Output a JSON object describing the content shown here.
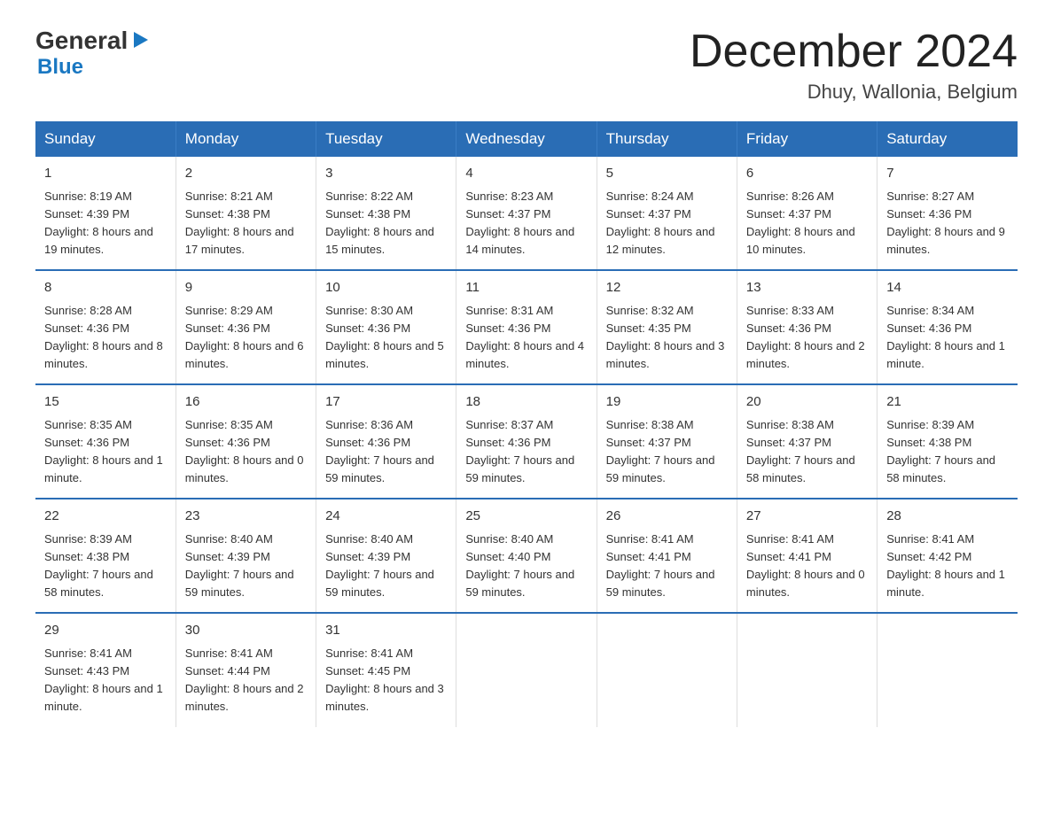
{
  "logo": {
    "general": "General",
    "triangle": "▶",
    "blue": "Blue"
  },
  "title": "December 2024",
  "location": "Dhuy, Wallonia, Belgium",
  "headers": [
    "Sunday",
    "Monday",
    "Tuesday",
    "Wednesday",
    "Thursday",
    "Friday",
    "Saturday"
  ],
  "weeks": [
    [
      {
        "day": "1",
        "sunrise": "8:19 AM",
        "sunset": "4:39 PM",
        "daylight": "8 hours and 19 minutes."
      },
      {
        "day": "2",
        "sunrise": "8:21 AM",
        "sunset": "4:38 PM",
        "daylight": "8 hours and 17 minutes."
      },
      {
        "day": "3",
        "sunrise": "8:22 AM",
        "sunset": "4:38 PM",
        "daylight": "8 hours and 15 minutes."
      },
      {
        "day": "4",
        "sunrise": "8:23 AM",
        "sunset": "4:37 PM",
        "daylight": "8 hours and 14 minutes."
      },
      {
        "day": "5",
        "sunrise": "8:24 AM",
        "sunset": "4:37 PM",
        "daylight": "8 hours and 12 minutes."
      },
      {
        "day": "6",
        "sunrise": "8:26 AM",
        "sunset": "4:37 PM",
        "daylight": "8 hours and 10 minutes."
      },
      {
        "day": "7",
        "sunrise": "8:27 AM",
        "sunset": "4:36 PM",
        "daylight": "8 hours and 9 minutes."
      }
    ],
    [
      {
        "day": "8",
        "sunrise": "8:28 AM",
        "sunset": "4:36 PM",
        "daylight": "8 hours and 8 minutes."
      },
      {
        "day": "9",
        "sunrise": "8:29 AM",
        "sunset": "4:36 PM",
        "daylight": "8 hours and 6 minutes."
      },
      {
        "day": "10",
        "sunrise": "8:30 AM",
        "sunset": "4:36 PM",
        "daylight": "8 hours and 5 minutes."
      },
      {
        "day": "11",
        "sunrise": "8:31 AM",
        "sunset": "4:36 PM",
        "daylight": "8 hours and 4 minutes."
      },
      {
        "day": "12",
        "sunrise": "8:32 AM",
        "sunset": "4:35 PM",
        "daylight": "8 hours and 3 minutes."
      },
      {
        "day": "13",
        "sunrise": "8:33 AM",
        "sunset": "4:36 PM",
        "daylight": "8 hours and 2 minutes."
      },
      {
        "day": "14",
        "sunrise": "8:34 AM",
        "sunset": "4:36 PM",
        "daylight": "8 hours and 1 minute."
      }
    ],
    [
      {
        "day": "15",
        "sunrise": "8:35 AM",
        "sunset": "4:36 PM",
        "daylight": "8 hours and 1 minute."
      },
      {
        "day": "16",
        "sunrise": "8:35 AM",
        "sunset": "4:36 PM",
        "daylight": "8 hours and 0 minutes."
      },
      {
        "day": "17",
        "sunrise": "8:36 AM",
        "sunset": "4:36 PM",
        "daylight": "7 hours and 59 minutes."
      },
      {
        "day": "18",
        "sunrise": "8:37 AM",
        "sunset": "4:36 PM",
        "daylight": "7 hours and 59 minutes."
      },
      {
        "day": "19",
        "sunrise": "8:38 AM",
        "sunset": "4:37 PM",
        "daylight": "7 hours and 59 minutes."
      },
      {
        "day": "20",
        "sunrise": "8:38 AM",
        "sunset": "4:37 PM",
        "daylight": "7 hours and 58 minutes."
      },
      {
        "day": "21",
        "sunrise": "8:39 AM",
        "sunset": "4:38 PM",
        "daylight": "7 hours and 58 minutes."
      }
    ],
    [
      {
        "day": "22",
        "sunrise": "8:39 AM",
        "sunset": "4:38 PM",
        "daylight": "7 hours and 58 minutes."
      },
      {
        "day": "23",
        "sunrise": "8:40 AM",
        "sunset": "4:39 PM",
        "daylight": "7 hours and 59 minutes."
      },
      {
        "day": "24",
        "sunrise": "8:40 AM",
        "sunset": "4:39 PM",
        "daylight": "7 hours and 59 minutes."
      },
      {
        "day": "25",
        "sunrise": "8:40 AM",
        "sunset": "4:40 PM",
        "daylight": "7 hours and 59 minutes."
      },
      {
        "day": "26",
        "sunrise": "8:41 AM",
        "sunset": "4:41 PM",
        "daylight": "7 hours and 59 minutes."
      },
      {
        "day": "27",
        "sunrise": "8:41 AM",
        "sunset": "4:41 PM",
        "daylight": "8 hours and 0 minutes."
      },
      {
        "day": "28",
        "sunrise": "8:41 AM",
        "sunset": "4:42 PM",
        "daylight": "8 hours and 1 minute."
      }
    ],
    [
      {
        "day": "29",
        "sunrise": "8:41 AM",
        "sunset": "4:43 PM",
        "daylight": "8 hours and 1 minute."
      },
      {
        "day": "30",
        "sunrise": "8:41 AM",
        "sunset": "4:44 PM",
        "daylight": "8 hours and 2 minutes."
      },
      {
        "day": "31",
        "sunrise": "8:41 AM",
        "sunset": "4:45 PM",
        "daylight": "8 hours and 3 minutes."
      },
      null,
      null,
      null,
      null
    ]
  ],
  "labels": {
    "sunrise": "Sunrise:",
    "sunset": "Sunset:",
    "daylight": "Daylight:"
  }
}
